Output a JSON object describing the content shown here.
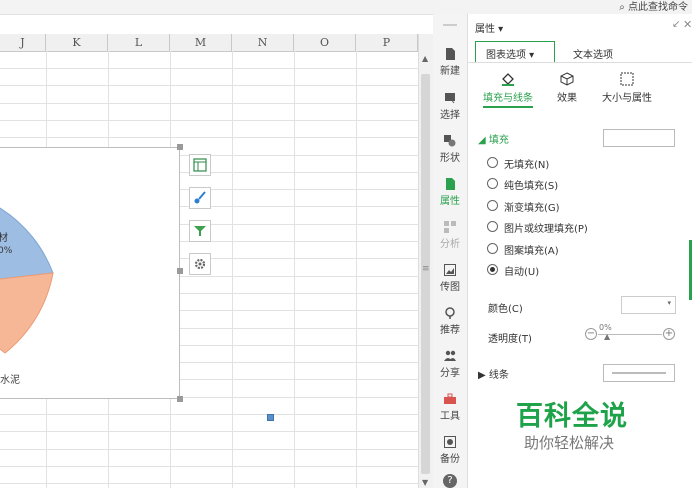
{
  "topbar": {
    "search_hint": "点此查找命令"
  },
  "columns": [
    "J",
    "K",
    "L",
    "M",
    "N",
    "O",
    "P"
  ],
  "chart": {
    "slice_label_1": "材",
    "slice_label_1_pct": "0%",
    "slice_label_2": "水泥",
    "colors": {
      "blue_slice": "#9dbde2",
      "orange_slice": "#f6b796"
    }
  },
  "chart_tools": [
    {
      "name": "chart-elements-icon"
    },
    {
      "name": "chart-style-brush-icon"
    },
    {
      "name": "chart-filter-icon"
    },
    {
      "name": "chart-settings-gear-icon"
    }
  ],
  "sidenav": {
    "items": [
      "新建",
      "选择",
      "形状",
      "属性",
      "分析",
      "传图",
      "推荐",
      "分享",
      "工具",
      "备份"
    ]
  },
  "panel": {
    "title": "属性 ▾",
    "tab_chart": "图表选项 ▾",
    "tab_text": "文本选项",
    "subtab_fill": "填充与线条",
    "subtab_effect": "效果",
    "subtab_size": "大小与属性",
    "fill_header": "填充",
    "fill_options": [
      "无填充(N)",
      "纯色填充(S)",
      "渐变填充(G)",
      "图片或纹理填充(P)",
      "图案填充(A)",
      "自动(U)"
    ],
    "selected_option": "自动(U)",
    "color_label": "颜色(C)",
    "opacity_label": "透明度(T)",
    "opacity_value": "0%",
    "line_header": "线条"
  },
  "watermark": {
    "title": "百科全说",
    "subtitle": "助你轻松解决"
  },
  "colors": {
    "accent_green": "#29a14d",
    "watermark_green": "#1fa34a"
  }
}
